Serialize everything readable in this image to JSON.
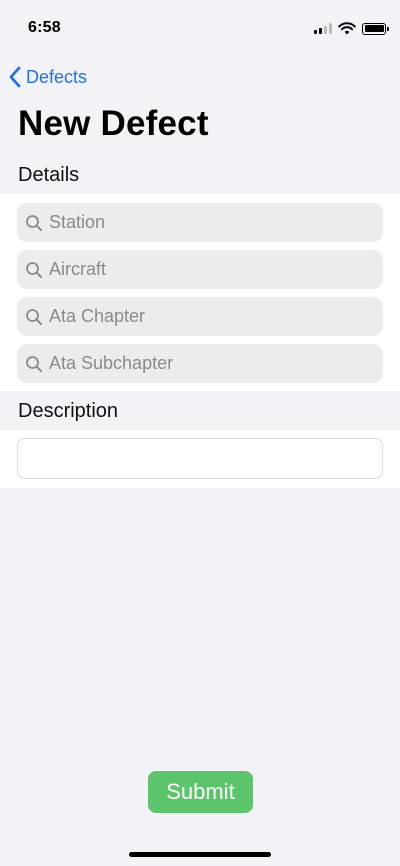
{
  "status_bar": {
    "time": "6:58",
    "icons": [
      "cellular-signal-icon",
      "wifi-icon",
      "battery-icon"
    ]
  },
  "nav": {
    "back_label": "Defects",
    "back_icon": "chevron-left-icon",
    "accent_color": "#1f73e8"
  },
  "page": {
    "title": "New Defect"
  },
  "details": {
    "header": "Details",
    "fields": [
      {
        "placeholder": "Station",
        "icon": "search-icon"
      },
      {
        "placeholder": "Aircraft",
        "icon": "search-icon"
      },
      {
        "placeholder": "Ata Chapter",
        "icon": "search-icon"
      },
      {
        "placeholder": "Ata Subchapter",
        "icon": "search-icon"
      }
    ]
  },
  "description": {
    "header": "Description",
    "value": "",
    "placeholder": ""
  },
  "actions": {
    "submit_label": "Submit",
    "submit_color": "#5cc46a"
  }
}
